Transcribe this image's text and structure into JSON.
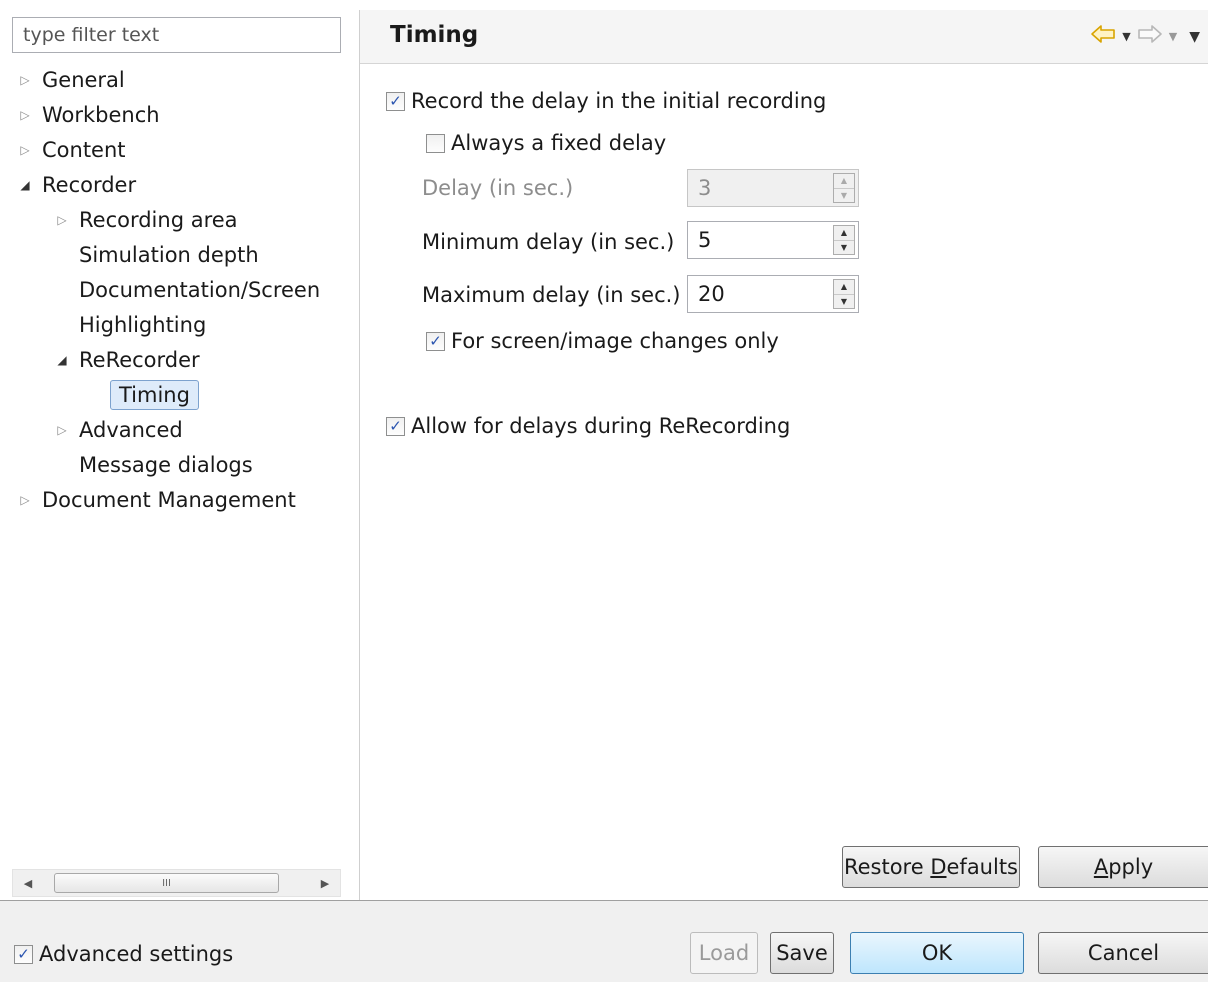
{
  "filter": {
    "placeholder": "type filter text"
  },
  "tree": [
    {
      "label": "General",
      "level": 0,
      "twisty": "collapsed"
    },
    {
      "label": "Workbench",
      "level": 0,
      "twisty": "collapsed"
    },
    {
      "label": "Content",
      "level": 0,
      "twisty": "collapsed"
    },
    {
      "label": "Recorder",
      "level": 0,
      "twisty": "expanded"
    },
    {
      "label": "Recording area",
      "level": 1,
      "twisty": "collapsed"
    },
    {
      "label": "Simulation depth",
      "level": 1,
      "twisty": "none"
    },
    {
      "label": "Documentation/Screen",
      "level": 1,
      "twisty": "none"
    },
    {
      "label": "Highlighting",
      "level": 1,
      "twisty": "none"
    },
    {
      "label": "ReRecorder",
      "level": 1,
      "twisty": "expanded"
    },
    {
      "label": "Timing",
      "level": 2,
      "twisty": "none",
      "selected": true
    },
    {
      "label": "Advanced",
      "level": 1,
      "twisty": "collapsed"
    },
    {
      "label": "Message dialogs",
      "level": 1,
      "twisty": "none"
    },
    {
      "label": "Document Management",
      "level": 0,
      "twisty": "collapsed"
    }
  ],
  "scrollbar": {
    "thumb_grip": "III"
  },
  "page": {
    "title": "Timing",
    "nav": {
      "back_icon": "back-arrow-icon",
      "forward_icon": "forward-arrow-icon",
      "menu_icon": "view-menu-icon"
    }
  },
  "options": {
    "record_delay": {
      "label": "Record the delay in the initial recording",
      "checked": true
    },
    "fixed_delay": {
      "label": "Always a fixed delay",
      "checked": false
    },
    "delay": {
      "label": "Delay (in sec.)",
      "value": "3",
      "enabled": false
    },
    "min_delay": {
      "label": "Minimum delay (in sec.)",
      "value": "5",
      "enabled": true
    },
    "max_delay": {
      "label": "Maximum delay (in sec.)",
      "value": "20",
      "enabled": true
    },
    "screen_changes": {
      "label": "For screen/image changes only",
      "checked": true
    },
    "allow_delays": {
      "label": "Allow for delays during ReRecording",
      "checked": true
    }
  },
  "page_buttons": {
    "restore_prefix": "Restore ",
    "restore_mnemonic": "D",
    "restore_suffix": "efaults",
    "apply_mnemonic": "A",
    "apply_suffix": "pply"
  },
  "footer": {
    "advanced_settings": {
      "label": "Advanced settings",
      "checked": true
    },
    "load": "Load",
    "save": "Save",
    "ok": "OK",
    "cancel": "Cancel"
  },
  "colors": {
    "selection_bg": "#deebfa",
    "selection_border": "#7da2ce",
    "default_button": "#bee6fd",
    "check": "#2b55b0"
  }
}
